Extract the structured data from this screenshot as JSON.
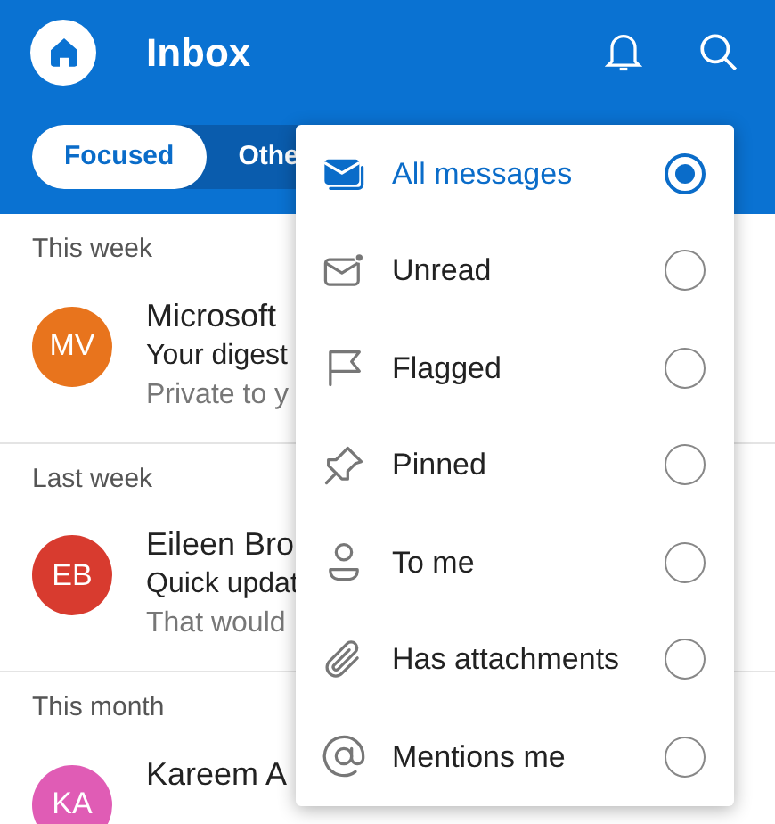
{
  "header": {
    "title": "Inbox"
  },
  "tabs": [
    {
      "label": "Focused",
      "selected": true
    },
    {
      "label": "Othe",
      "selected": false
    }
  ],
  "sections": [
    {
      "heading": "This week",
      "messages": [
        {
          "initials": "MV",
          "color": "#e8741d",
          "sender": "Microsoft",
          "subject": "Your digest",
          "preview": "Private to y"
        }
      ]
    },
    {
      "heading": "Last week",
      "messages": [
        {
          "initials": "EB",
          "color": "#d83b2f",
          "sender": "Eileen Bro",
          "subject": "Quick updat",
          "preview": "That would"
        }
      ]
    },
    {
      "heading": "This month",
      "messages": [
        {
          "initials": "KA",
          "color": "#e05cb5",
          "sender": "Kareem A"
        }
      ]
    }
  ],
  "filter_menu": [
    {
      "kind": "all",
      "label": "All messages",
      "selected": true
    },
    {
      "kind": "unread",
      "label": "Unread",
      "selected": false
    },
    {
      "kind": "flagged",
      "label": "Flagged",
      "selected": false
    },
    {
      "kind": "pinned",
      "label": "Pinned",
      "selected": false
    },
    {
      "kind": "tome",
      "label": "To me",
      "selected": false
    },
    {
      "kind": "attachments",
      "label": "Has attachments",
      "selected": false
    },
    {
      "kind": "mentions",
      "label": "Mentions me",
      "selected": false
    }
  ]
}
